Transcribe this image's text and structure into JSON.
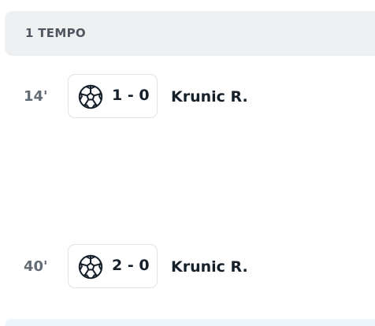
{
  "period": {
    "title": "1 TEMPO"
  },
  "events": [
    {
      "minute": "14'",
      "icon": "soccer-ball-icon",
      "score": "1 - 0",
      "player": "Krunic R."
    },
    {
      "minute": "40'",
      "icon": "soccer-ball-icon",
      "score": "2 - 0",
      "player": "Krunic R."
    }
  ]
}
